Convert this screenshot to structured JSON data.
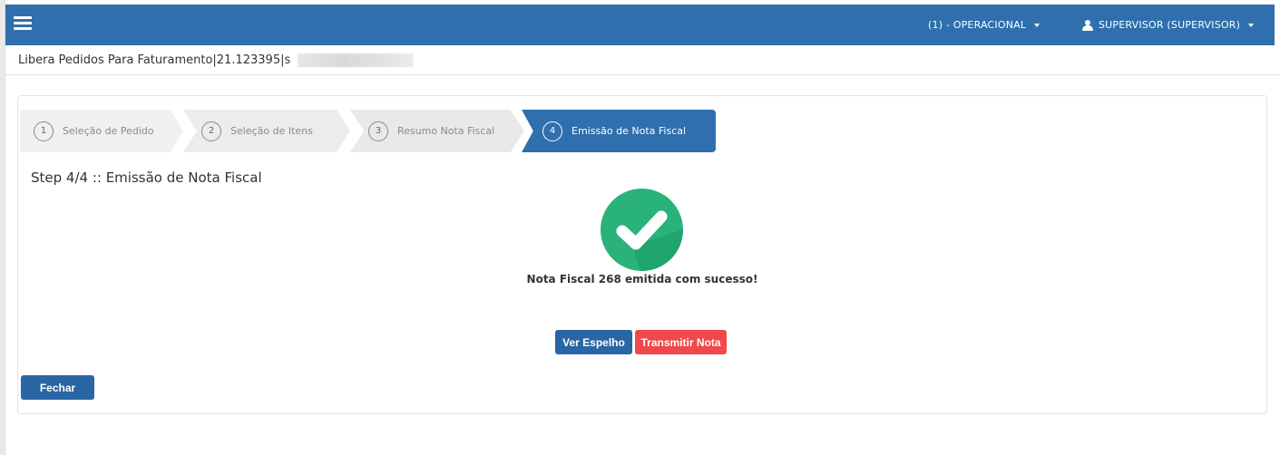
{
  "header": {
    "menu_operacional": "(1) - OPERACIONAL",
    "menu_user": "SUPERVISOR (SUPERVISOR)",
    "brand_color": "#2f6fad"
  },
  "breadcrumb": {
    "text": "Libera Pedidos Para Faturamento|21.123395|s"
  },
  "wizard": {
    "steps": [
      {
        "number": "1",
        "label": "Seleção de Pedido",
        "active": false
      },
      {
        "number": "2",
        "label": "Seleção de Itens",
        "active": false
      },
      {
        "number": "3",
        "label": "Resumo Nota Fiscal",
        "active": false
      },
      {
        "number": "4",
        "label": "Emissão de Nota Fiscal",
        "active": true
      }
    ],
    "step_title": "Step 4/4 :: Emissão de Nota Fiscal"
  },
  "result": {
    "icon": "check-circle-icon",
    "message": "Nota Fiscal 268 emitida com sucesso!",
    "success_color": "#2ab27b"
  },
  "actions": {
    "ver_espelho": "Ver Espelho",
    "transmitir_nota": "Transmitir Nota",
    "fechar": "Fechar"
  }
}
